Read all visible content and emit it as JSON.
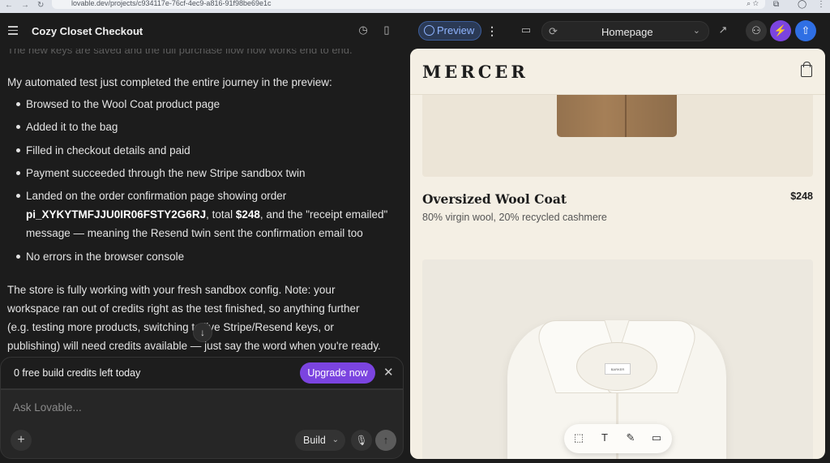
{
  "browser": {
    "url": "lovable.dev/projects/c934117e-76cf-4ec9-a816-91f98be69e1c"
  },
  "topbar": {
    "project_title": "Cozy Closet Checkout",
    "preview_label": "Preview",
    "path_label": "Homepage"
  },
  "chat": {
    "faded_line": "The new keys are saved and the full purchase flow now works end to end.",
    "intro": "My automated test just completed the entire journey in the preview:",
    "bullets": [
      "Browsed to the Wool Coat product page",
      "Added it to the bag",
      "Filled in checkout details and paid",
      "Payment succeeded through the new Stripe sandbox twin"
    ],
    "order_bullet": {
      "prefix": "Landed on the order confirmation page showing order",
      "order_id": "pi_XYKYTMFJJU0IR06FSTY2G6RJ",
      "mid": ", total ",
      "total": "$248",
      "suffix": ", and the \"receipt emailed\"",
      "line3": "message — meaning the Resend twin sent the confirmation email too"
    },
    "last_bullet": "No errors in the browser console",
    "closing_lines": [
      "The store is fully working with your fresh sandbox config. Note: your",
      "workspace ran out of credits right as the test finished, so anything further",
      "(e.g. testing more products, switching to live Stripe/Resend keys, or",
      "publishing) will need credits available — just say the word when you're ready."
    ],
    "credits_text": "0 free build credits left today",
    "upgrade_label": "Upgrade now",
    "input_placeholder": "Ask Lovable...",
    "build_label": "Build"
  },
  "preview": {
    "brand": "MERCER",
    "product_name": "Oversized Wool Coat",
    "product_price": "$248",
    "product_desc": "80% virgin wool, 20% recycled cashmere",
    "shirt_label": "BARKER"
  },
  "colors": {
    "accent_purple": "#7b44e0",
    "preview_blue": "#8fb4ff",
    "cream": "#f4efe4"
  }
}
